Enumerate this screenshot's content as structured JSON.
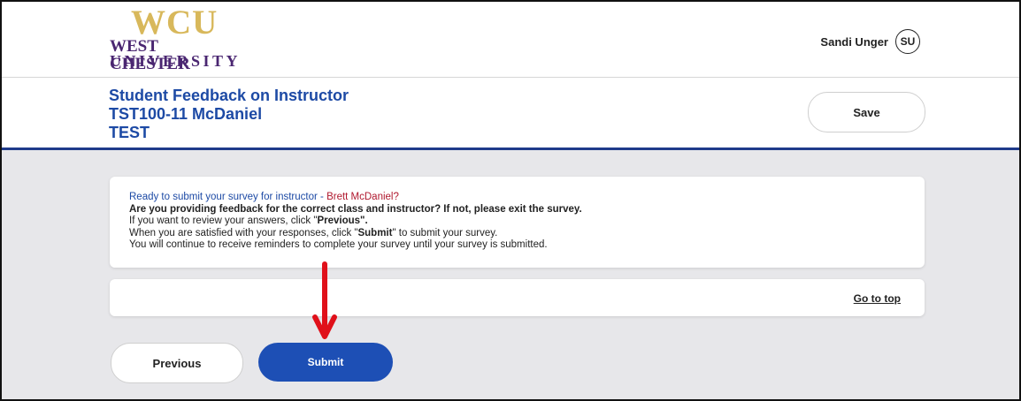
{
  "logo": {
    "wcu": "WCU",
    "line1": "WEST CHESTER",
    "line2": "UNIVERSITY"
  },
  "user": {
    "name": "Sandi Unger",
    "initials": "SU"
  },
  "header": {
    "title": "Student Feedback on Instructor",
    "course": "TST100-11 McDaniel",
    "term": "TEST",
    "save_label": "Save"
  },
  "card": {
    "ready_prefix": "Ready to submit your survey for instructor - ",
    "instructor_name": "Brett McDaniel?",
    "confirm_question": "Are you providing feedback for the correct class and instructor? If not, please exit the survey.",
    "review_prefix": "If you want to review your answers, click \"",
    "review_button_word": "Previous\".",
    "submit_prefix": "When you are satisfied with your responses, click \"",
    "submit_word": "Submit",
    "submit_suffix": "\" to submit your survey.",
    "reminder": "You will continue to receive reminders to complete your survey until your survey is submitted."
  },
  "navigation": {
    "go_to_top": "Go to top",
    "previous_label": "Previous",
    "submit_label": "Submit"
  },
  "annotation": {
    "arrow_color": "#e0101a"
  },
  "colors": {
    "brand_blue": "#1d4aa5",
    "submit_blue": "#1d4fb5",
    "logo_gold": "#d8b85b",
    "logo_purple": "#4a2671",
    "instructor_red": "#b0182e"
  }
}
